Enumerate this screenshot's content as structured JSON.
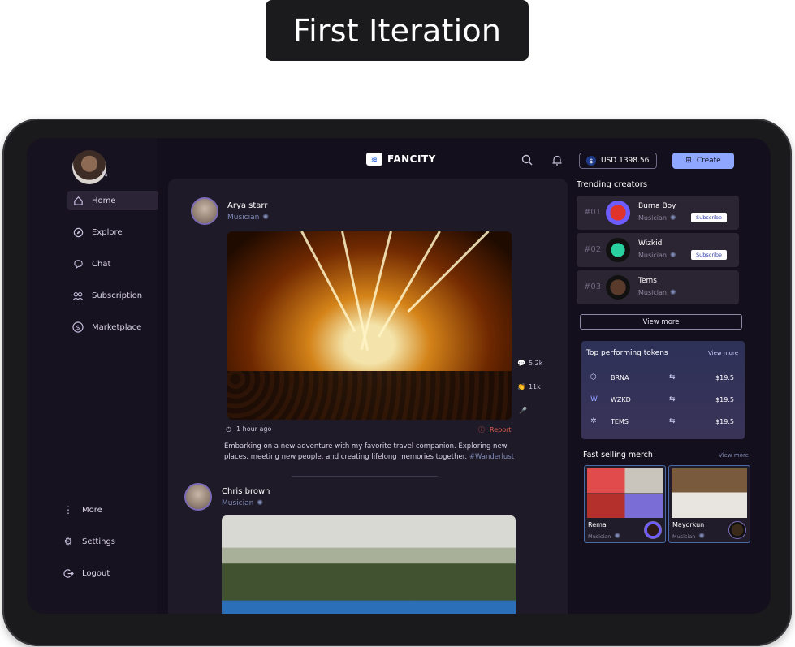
{
  "heading": "First Iteration",
  "app": {
    "logo_text": "FANCITY",
    "balance": "USD 1398.56",
    "balance_icon": "$",
    "create_label": "Create"
  },
  "sidebar": {
    "items": [
      {
        "label": "Home",
        "icon": "home-icon"
      },
      {
        "label": "Explore",
        "icon": "compass-icon"
      },
      {
        "label": "Chat",
        "icon": "chat-icon"
      },
      {
        "label": "Subscription",
        "icon": "users-icon"
      },
      {
        "label": "Marketplace",
        "icon": "dollar-icon"
      }
    ],
    "bottom": [
      {
        "label": "More",
        "icon": "more-icon"
      },
      {
        "label": "Settings",
        "icon": "gear-icon"
      },
      {
        "label": "Logout",
        "icon": "logout-icon"
      }
    ]
  },
  "feed": {
    "posts": [
      {
        "name": "Arya starr",
        "role": "Musician",
        "time": "1 hour ago",
        "report": "Report",
        "comments": "5.2k",
        "claps": "11k",
        "caption": "Embarking on a new adventure with my favorite travel companion. Exploring new places, meeting new people, and creating lifelong memories together.",
        "hashtag": "#Wanderlust"
      },
      {
        "name": "Chris brown",
        "role": "Musician"
      }
    ]
  },
  "trending": {
    "title": "Trending creators",
    "creators": [
      {
        "rank": "#01",
        "name": "Burna Boy",
        "role": "Musician",
        "action": "Subscribe"
      },
      {
        "rank": "#02",
        "name": "Wizkid",
        "role": "Musician",
        "action": "Subscribe"
      },
      {
        "rank": "#03",
        "name": "Tems",
        "role": "Musician"
      }
    ],
    "view_more": "View more"
  },
  "tokens": {
    "title": "Top performing tokens",
    "view_more": "View more",
    "rows": [
      {
        "name": "BRNA",
        "price": "$19.5"
      },
      {
        "name": "WZKD",
        "price": "$19.5"
      },
      {
        "name": "TEMS",
        "price": "$19.5"
      }
    ]
  },
  "merch": {
    "title": "Fast selling merch",
    "view_more": "View more",
    "items": [
      {
        "name": "Rema",
        "role": "Musician"
      },
      {
        "name": "Mayorkun",
        "role": "Musician"
      }
    ]
  },
  "colors": {
    "accent": "#8fa7ff",
    "background": "#140f1c",
    "report": "#e05b4d",
    "link": "#7f8cb8"
  }
}
